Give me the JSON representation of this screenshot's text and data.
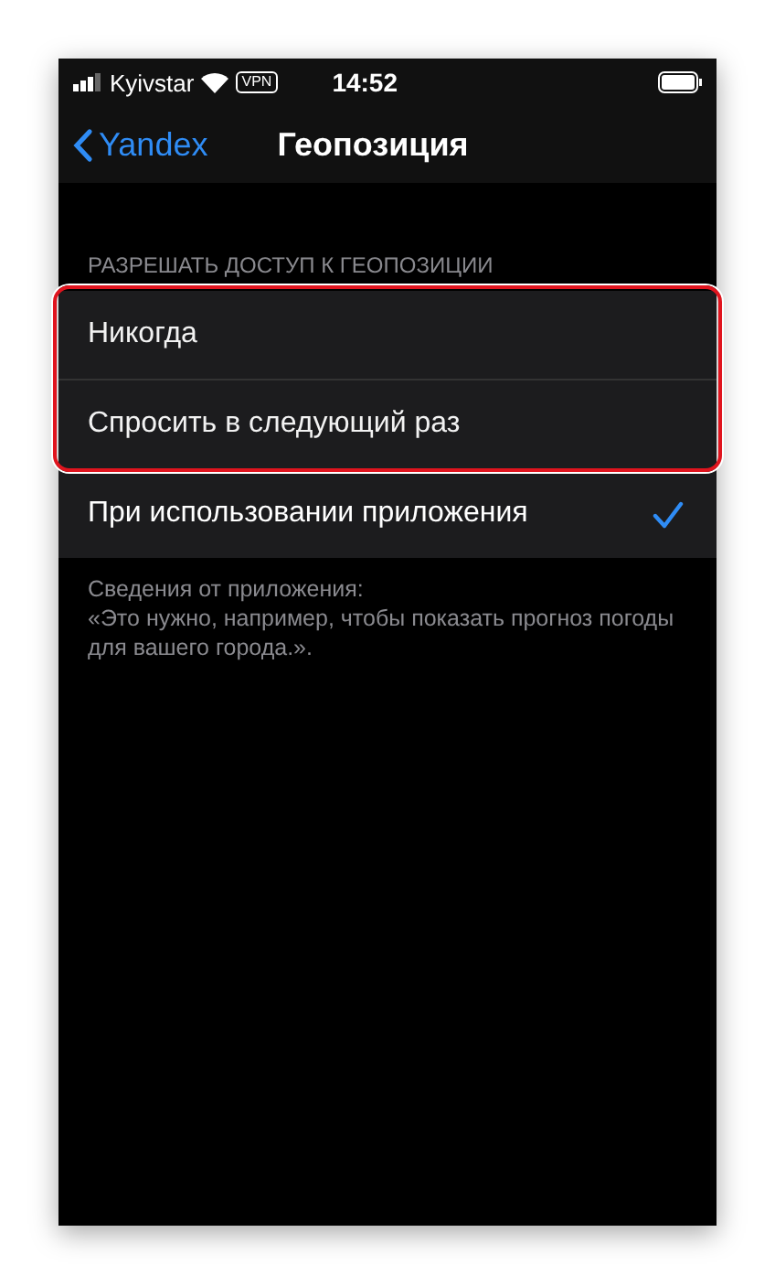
{
  "status_bar": {
    "carrier": "Kyivstar",
    "vpn": "VPN",
    "time": "14:52"
  },
  "nav": {
    "back": "Yandex",
    "title": "Геопозиция"
  },
  "section_header": "РАЗРЕШАТЬ ДОСТУП К ГЕОПОЗИЦИИ",
  "options": [
    {
      "label": "Никогда",
      "selected": false,
      "highlighted": true
    },
    {
      "label": "Спросить в следующий раз",
      "selected": false,
      "highlighted": true
    },
    {
      "label": "При использовании приложения",
      "selected": true,
      "highlighted": false
    }
  ],
  "footer": [
    "Сведения от приложения:",
    "«Это нужно, например, чтобы показать прогноз погоды для вашего города.»."
  ]
}
